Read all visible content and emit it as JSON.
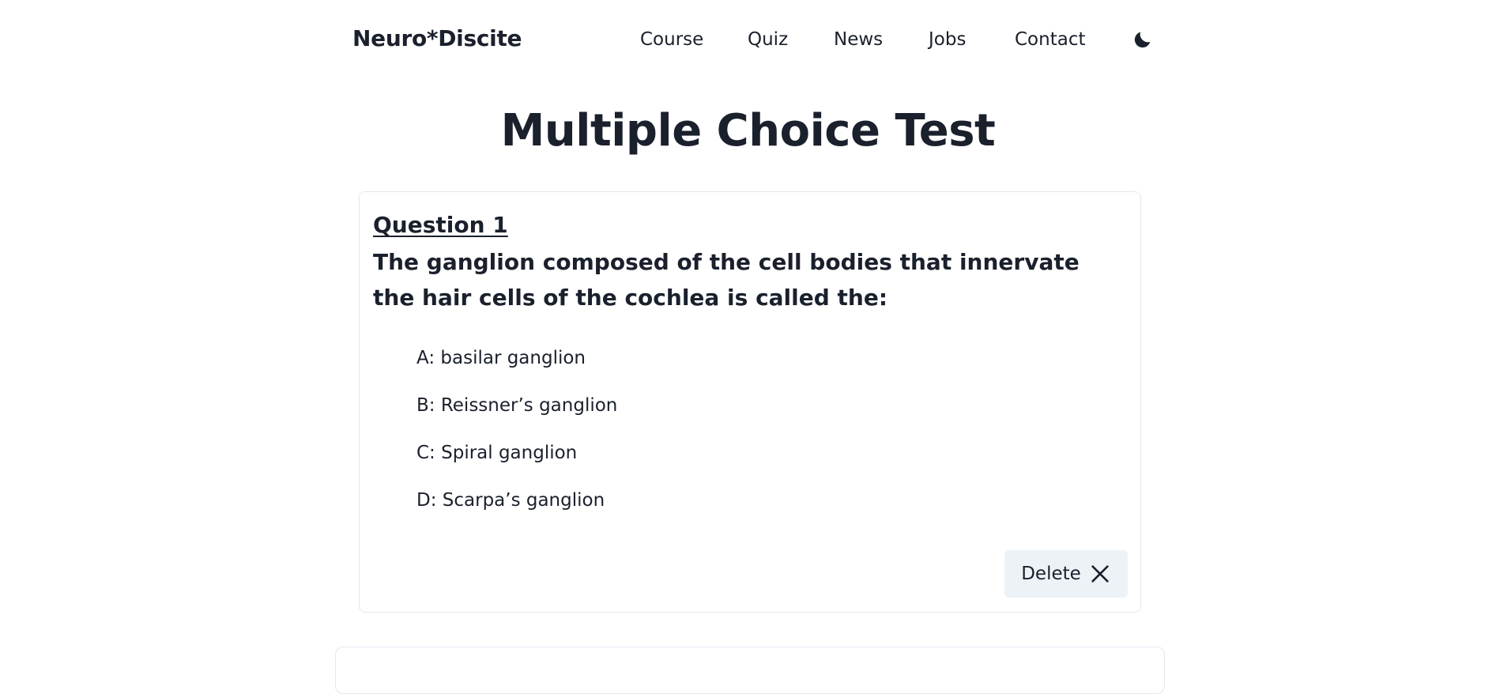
{
  "brand": "Neuro*Discite",
  "nav": {
    "items": [
      {
        "label": "Course"
      },
      {
        "label": "Quiz"
      },
      {
        "label": "News"
      },
      {
        "label": "Jobs"
      },
      {
        "label": "Contact"
      }
    ],
    "theme_toggle_icon": "moon-icon"
  },
  "page": {
    "title": "Multiple Choice Test"
  },
  "question": {
    "number_label": "Question 1",
    "text": "The ganglion composed of the cell bodies that innervate the hair cells of the cochlea is called the:",
    "answers": [
      {
        "label": "A: basilar ganglion"
      },
      {
        "label": "B: Reissner’s ganglion"
      },
      {
        "label": "C: Spiral ganglion"
      },
      {
        "label": "D: Scarpa’s ganglion"
      }
    ],
    "delete_label": "Delete",
    "delete_icon": "close-icon"
  },
  "colors": {
    "text": "#1a202c",
    "border": "#e2e8f0",
    "button_bg": "#edf2f7",
    "background": "#ffffff"
  }
}
